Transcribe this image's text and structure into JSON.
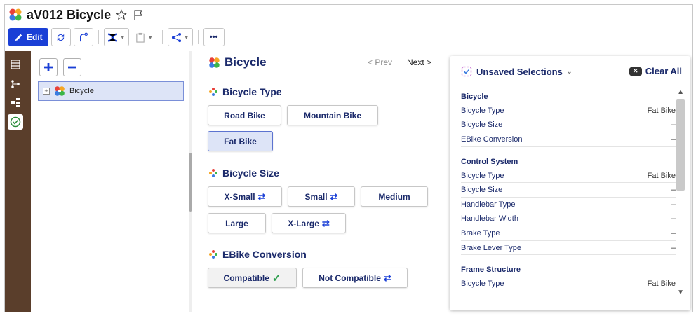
{
  "window": {
    "title": "aV012 Bicycle"
  },
  "toolbar": {
    "edit_label": "Edit",
    "more_label": "•••"
  },
  "tree": {
    "root_label": "Bicycle",
    "expander": "+"
  },
  "main": {
    "title": "Bicycle",
    "prev_label": "< Prev",
    "next_label": "Next >",
    "sections": [
      {
        "title": "Bicycle Type",
        "options": [
          "Road Bike",
          "Mountain Bike",
          "Fat Bike"
        ]
      },
      {
        "title": "Bicycle Size",
        "options": [
          "X-Small",
          "Small",
          "Medium",
          "Large",
          "X-Large"
        ]
      },
      {
        "title": "EBike Conversion",
        "options": [
          "Compatible",
          "Not Compatible"
        ]
      }
    ],
    "selected": {
      "bicycle_type": "Fat Bike",
      "ebike_conversion": "Compatible"
    }
  },
  "summary": {
    "title": "Unsaved Selections",
    "clear_label": "Clear All",
    "groups": [
      {
        "title": "Bicycle",
        "rows": [
          {
            "k": "Bicycle Type",
            "v": "Fat Bike"
          },
          {
            "k": "Bicycle Size",
            "v": "–"
          },
          {
            "k": "EBike Conversion",
            "v": "–"
          }
        ]
      },
      {
        "title": "Control System",
        "rows": [
          {
            "k": "Bicycle Type",
            "v": "Fat Bike"
          },
          {
            "k": "Bicycle Size",
            "v": "–"
          },
          {
            "k": "Handlebar Type",
            "v": "–"
          },
          {
            "k": "Handlebar Width",
            "v": "–"
          },
          {
            "k": "Brake Type",
            "v": "–"
          },
          {
            "k": "Brake Lever Type",
            "v": "–"
          }
        ]
      },
      {
        "title": "Frame Structure",
        "rows": [
          {
            "k": "Bicycle Type",
            "v": "Fat Bike"
          }
        ]
      }
    ]
  },
  "colors": {
    "accent": "#1a3fd6",
    "navy": "#1b2a6b",
    "rail": "#5a3e2b",
    "selected_bg": "#dde4f7",
    "check": "#2a9d4a"
  },
  "icons": [
    "pencil-icon",
    "refresh-icon",
    "branch-icon",
    "network-icon",
    "clipboard-icon",
    "share-icon",
    "star-icon",
    "flag-icon",
    "pinwheel-icon",
    "swap-icon",
    "check-icon"
  ]
}
